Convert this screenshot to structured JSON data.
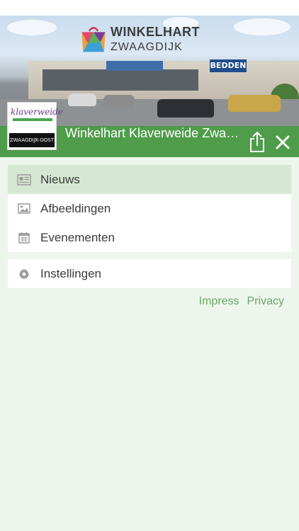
{
  "header": {
    "brand_name": "WINKELHART",
    "brand_sub": "ZWAAGDIJK",
    "store_sign": "BEDDEN",
    "logo_word": "klaverweide",
    "logo_caption": "ZWAAGDIJK-OOST",
    "title": "Winkelhart Klaverweide Zwaagdijk",
    "share_icon": "share-icon",
    "close_icon": "close-icon",
    "accent_color": "#4f9c4a"
  },
  "menu": {
    "items": [
      {
        "label": "Nieuws",
        "icon": "newspaper-icon",
        "active": true
      },
      {
        "label": "Afbeeldingen",
        "icon": "image-icon",
        "active": false
      },
      {
        "label": "Evenementen",
        "icon": "calendar-icon",
        "active": false
      }
    ],
    "settings": {
      "label": "Instellingen",
      "icon": "gear-icon"
    }
  },
  "footer": {
    "impress": "Impress",
    "privacy": "Privacy"
  }
}
